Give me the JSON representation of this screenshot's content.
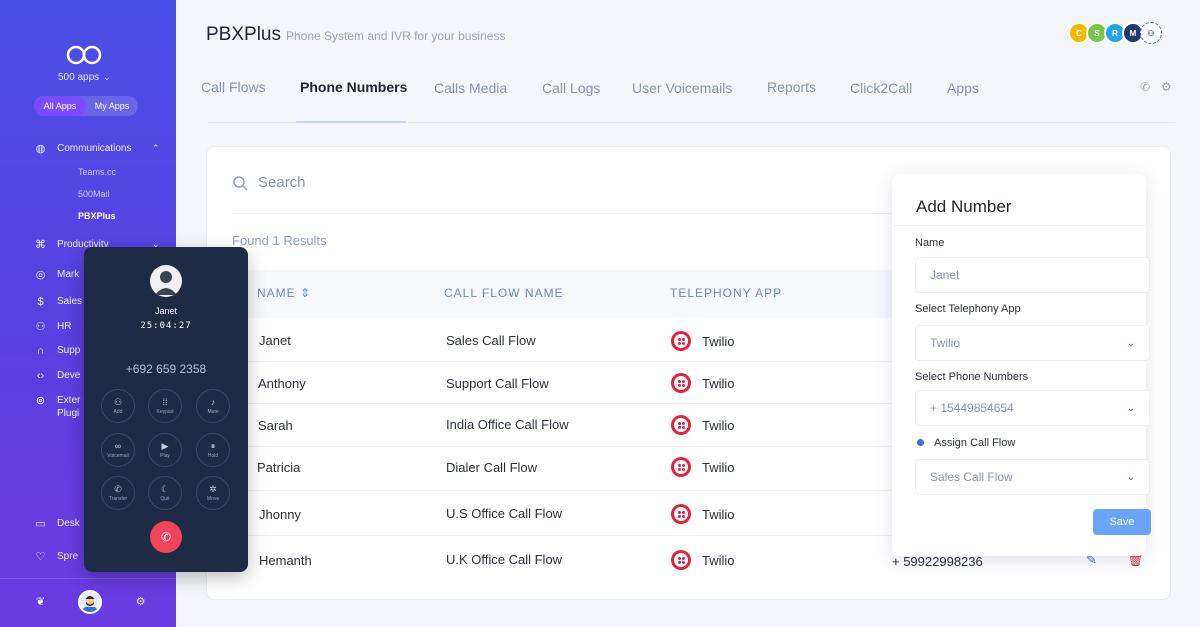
{
  "sidebar": {
    "apps_count": "500 apps",
    "toggle": [
      "All Apps",
      "My Apps"
    ],
    "communications": "Communications",
    "sub_items": [
      "Teams.cc",
      "500Mail",
      "PBXPlus"
    ],
    "productivity": "Productivity",
    "items": [
      "Mark",
      "Sales",
      "HR",
      "Supp",
      "Deve",
      "Exter",
      "Plugi",
      "Desk",
      "Spre"
    ]
  },
  "header": {
    "brand": "PBXPlus",
    "tagline": "Phone System and IVR for your business",
    "team": [
      "C",
      "S",
      "R",
      "M"
    ]
  },
  "tabs": [
    "Call Flows",
    "Phone Numbers",
    "Calls Media",
    "Call Logs",
    "User Voicemails",
    "Reports",
    "Click2Call",
    "Apps"
  ],
  "search": {
    "placeholder": "Search"
  },
  "found_text": "Found 1 Results",
  "table": {
    "headers": [
      "NAME",
      "CALL FLOW NAME",
      "TELEPHONY APP"
    ],
    "rows": [
      {
        "name": "Janet",
        "flow": "Sales Call Flow",
        "app": "Twilio"
      },
      {
        "name": "Anthony",
        "flow": "Support Call Flow",
        "app": "Twilio"
      },
      {
        "name": "Sarah",
        "flow": "India Office Call Flow",
        "app": "Twilio"
      },
      {
        "name": "Patricia",
        "flow": "Dialer Call Flow",
        "app": "Twilio"
      },
      {
        "name": "Jhonny",
        "flow": "U.S Office Call Flow",
        "app": "Twilio"
      },
      {
        "name": "Hemanth",
        "flow": "U.K Office Call Flow",
        "app": "Twilio"
      }
    ],
    "last_phone": "+ 59922998236"
  },
  "add_number": {
    "title": "Add Number",
    "name_label": "Name",
    "name_value": "Janet",
    "app_label": "Select Telephony App",
    "app_value": "Twilio",
    "phone_label": "Select Phone Numbers",
    "phone_value": "+ 15449854654",
    "flow_label": "Assign Call Flow",
    "flow_value": "Sales Call Flow",
    "save": "Save"
  },
  "dialer": {
    "name": "Janet",
    "time": "25:04:27",
    "number": "+692 659 2358",
    "keys": [
      "Add",
      "Keypad",
      "Mute",
      "Voicemail",
      "Play",
      "Hold",
      "Transfer",
      "Quit",
      "Move"
    ]
  },
  "colors": {
    "accent": "#3b6fd8",
    "sidebar": "#4a4fe6",
    "twilio": "#e0243e",
    "hangup": "#f0445a"
  }
}
